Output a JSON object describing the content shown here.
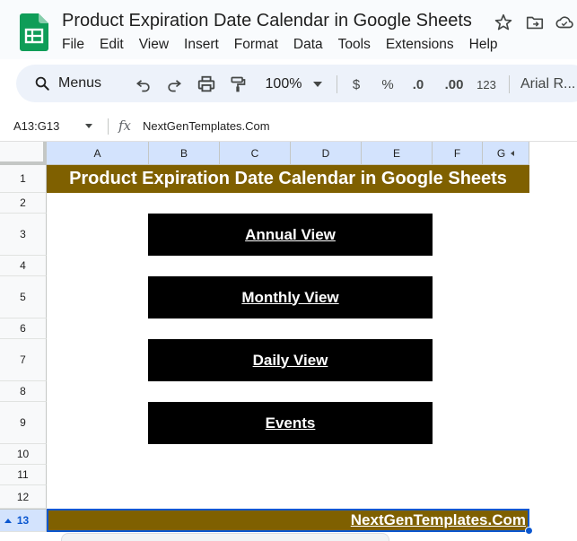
{
  "app": {
    "doc_title": "Product Expiration Date Calendar in Google Sheets",
    "menu": [
      "File",
      "Edit",
      "View",
      "Insert",
      "Format",
      "Data",
      "Tools",
      "Extensions",
      "Help"
    ]
  },
  "toolbar": {
    "search_label": "Menus",
    "zoom": "100%",
    "currency": "$",
    "percent": "%",
    "decrease_decimal": ".0",
    "increase_decimal": ".00",
    "number_format": "123",
    "font": "Arial R..."
  },
  "formula_bar": {
    "name_box": "A13:G13",
    "fx": "fx",
    "content": "NextGenTemplates.Com"
  },
  "grid": {
    "columns": [
      "A",
      "B",
      "C",
      "D",
      "E",
      "F",
      "G"
    ],
    "rows": [
      "1",
      "2",
      "3",
      "4",
      "5",
      "6",
      "7",
      "8",
      "9",
      "10",
      "11",
      "12",
      "13"
    ],
    "selected_row": "13"
  },
  "sheet": {
    "title": "Product Expiration Date Calendar in Google Sheets",
    "buttons": [
      "Annual View",
      "Monthly View",
      "Daily View",
      "Events"
    ],
    "footer": "NextGenTemplates.Com"
  },
  "colors": {
    "banner": "#7f6000",
    "button": "#000000",
    "selection": "#0b57d0",
    "header_selected": "#d3e3fd"
  }
}
